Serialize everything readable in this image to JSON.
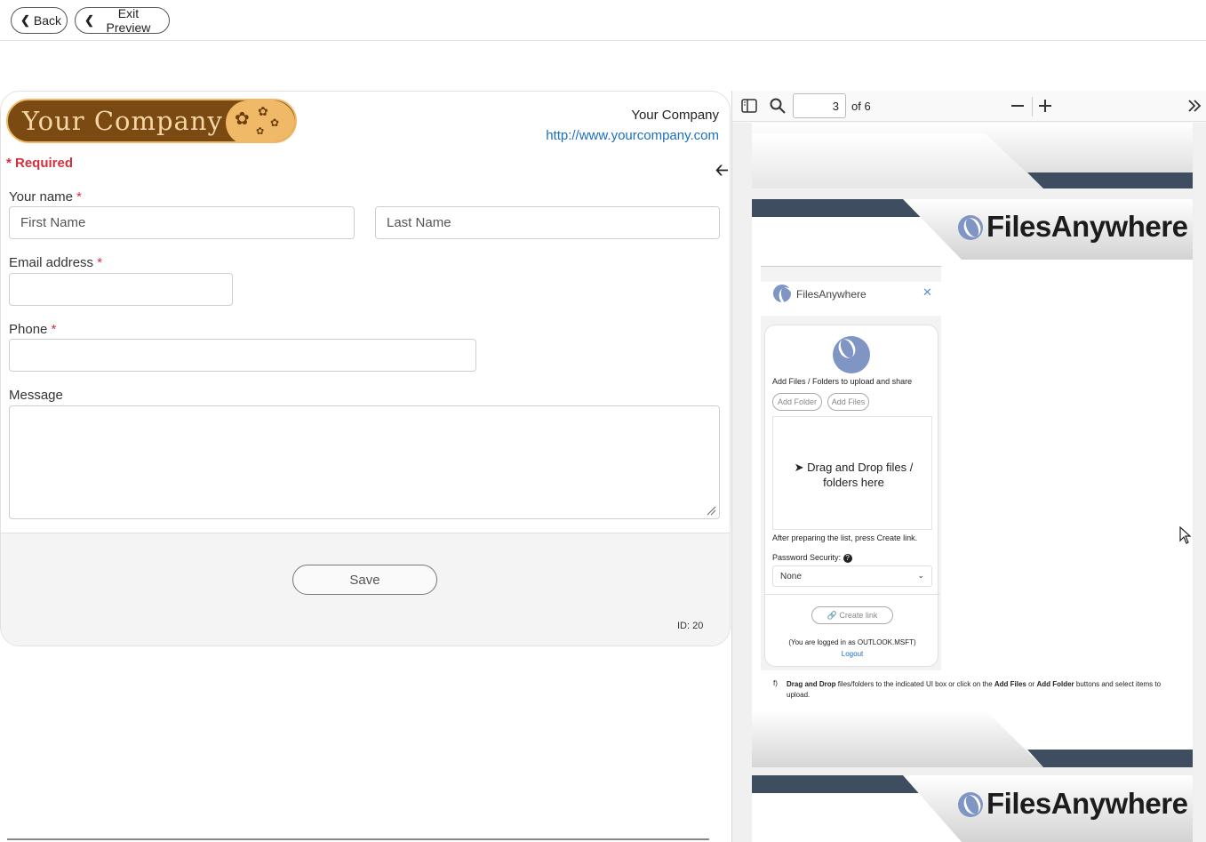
{
  "topbar": {
    "back_label": "Back",
    "exit_label": "Exit Preview"
  },
  "form": {
    "logo_text": "Your Company",
    "company_name": "Your Company",
    "company_url": "http://www.yourcompany.com",
    "required_label": "* Required",
    "name_label": "Your name",
    "first_placeholder": "First Name",
    "last_placeholder": "Last Name",
    "email_label": "Email address",
    "phone_label": "Phone",
    "message_label": "Message",
    "star": "*",
    "save_label": "Save",
    "id_text": "ID: 20"
  },
  "pdf": {
    "page_value": "3",
    "page_of": "of 6",
    "logo_text": "FilesAnywhere",
    "shot": {
      "header_title": "FilesAnywhere",
      "add_title": "Add Files / Folders to upload and share",
      "add_folder": "Add Folder",
      "add_files": "Add Files",
      "drop_text": "Drag and Drop files / folders here",
      "after_text": "After preparing the list, press Create link.",
      "password_label": "Password Security:",
      "password_value": "None",
      "create_link": "Create link",
      "logged_in": "(You are logged in as OUTLOOK.MSFT)",
      "logout": "Logout"
    },
    "instruction_marker": "f)",
    "instruction_bold1": "Drag and Drop",
    "instruction_text1": " files/folders to the indicated UI box or click on the ",
    "instruction_bold2": "Add Files",
    "instruction_text2": " or ",
    "instruction_bold3": "Add Folder",
    "instruction_text3": " buttons and select items to upload."
  },
  "colors": {
    "accent": "#1a6fc2",
    "required": "#d3303e",
    "banner_dark": "#3f4d61"
  }
}
